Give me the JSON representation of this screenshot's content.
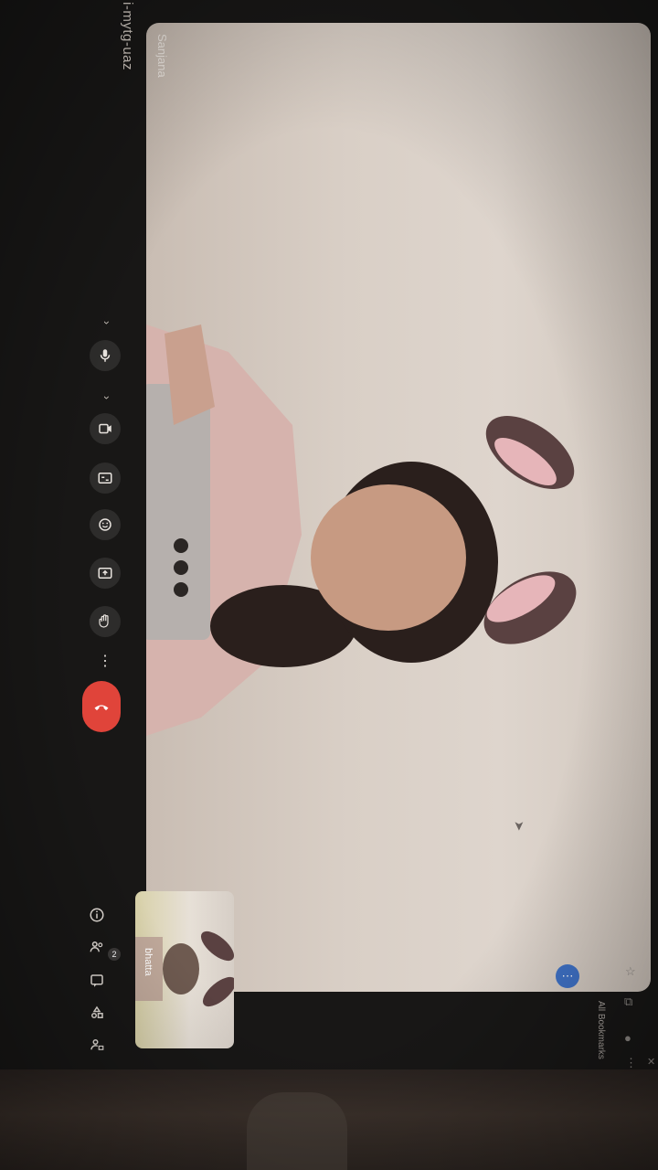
{
  "meeting": {
    "code_partial": "i-mytg-uaz"
  },
  "main_video": {
    "participant_name": "Sanjana"
  },
  "self_view": {
    "participant_name": "bhatta"
  },
  "controls": {
    "mic": "mic-icon",
    "camera": "camera-icon",
    "captions": "captions-icon",
    "emoji": "emoji-icon",
    "present": "present-icon",
    "raise_hand": "hand-icon",
    "more": "more-vert-icon",
    "leave": "call-end-icon"
  },
  "side_panel": {
    "people_count": "2"
  },
  "browser": {
    "bookmarks_label": "All Bookmarks"
  },
  "colors": {
    "leave_red": "#e0443a",
    "accent_blue": "#3f72c7"
  }
}
